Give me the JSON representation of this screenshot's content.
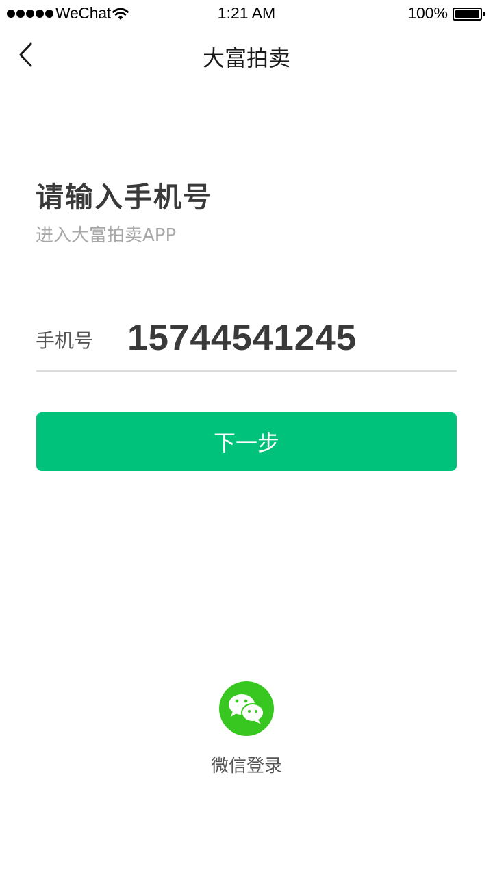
{
  "status_bar": {
    "carrier": "WeChat",
    "time": "1:21 AM",
    "battery_percent": "100%",
    "battery_level": 1.0,
    "signal_dots": 5
  },
  "nav": {
    "title": "大富拍卖",
    "back_icon": "chevron-left-icon"
  },
  "main": {
    "heading": "请输入手机号",
    "subheading": "进入大富拍卖APP",
    "phone_label": "手机号",
    "phone_value": "15744541245",
    "next_button_label": "下一步"
  },
  "wechat": {
    "icon": "wechat-icon",
    "label": "微信登录"
  },
  "colors": {
    "primary_green": "#00c27a",
    "wechat_green": "#38c720",
    "divider": "#dcdcdc"
  }
}
